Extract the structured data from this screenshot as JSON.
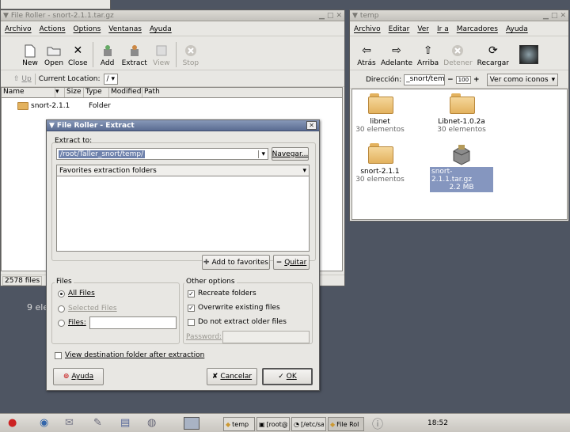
{
  "top_tab": {
    "label": ""
  },
  "file_roller": {
    "title": "File Roller - snort-2.1.1.tar.gz",
    "menu": [
      "Archivo",
      "Actions",
      "Options",
      "Ventanas",
      "Ayuda"
    ],
    "toolbar": {
      "new": "New",
      "open": "Open",
      "close": "Close",
      "add": "Add",
      "extract": "Extract",
      "view": "View",
      "stop": "Stop"
    },
    "location": {
      "up": "Up",
      "label": "Current Location:",
      "value": "/"
    },
    "columns": [
      "Name",
      "Size",
      "Type",
      "Modified",
      "Path"
    ],
    "rows": [
      {
        "name": "snort-2.1.1",
        "size": "",
        "type": "Folder",
        "modified": "",
        "path": ""
      }
    ],
    "status": "2578 files"
  },
  "desktop_label": "9 ele",
  "nautilus": {
    "title": "temp",
    "menu": [
      "Archivo",
      "Editar",
      "Ver",
      "Ir a",
      "Marcadores",
      "Ayuda"
    ],
    "toolbar": {
      "back": "Atrás",
      "forward": "Adelante",
      "up": "Arriba",
      "stop": "Detener",
      "reload": "Recargar"
    },
    "address_label": "Dirección:",
    "address_value": "_snort/temp",
    "zoom": "100",
    "view_as": "Ver como iconos",
    "items": [
      {
        "name": "libnet",
        "info": "30 elementos"
      },
      {
        "name": "Libnet-1.0.2a",
        "info": "30 elementos"
      },
      {
        "name": "snort-2.1.1",
        "info": "30 elementos"
      },
      {
        "name": "snort-2.1.1.tar.gz",
        "info": "2.2 MB"
      }
    ]
  },
  "extract_dialog": {
    "title": "File Roller - Extract",
    "extract_to_label": "Extract to:",
    "extract_to_value": "/root/Taller_snort/temp/",
    "browse": "Navegar...",
    "favorites_header": "Favorites extraction folders",
    "add_favorites": "Add to favorites",
    "remove": "Quitar",
    "files_group": "Files",
    "all_files": "All Files",
    "selected_files": "Selected Files",
    "files_opt": "Files:",
    "other_group": "Other options",
    "recreate": "Recreate folders",
    "overwrite": "Overwrite existing files",
    "no_older": "Do not extract older files",
    "password": "Password:",
    "view_dest": "View destination folder after extraction",
    "help": "Ayuda",
    "cancel": "Cancelar",
    "ok": "OK"
  },
  "taskbar": {
    "tasks": [
      "temp",
      "[root@l",
      "[/etc/sa",
      "File Rol"
    ],
    "clock": "18:52"
  }
}
